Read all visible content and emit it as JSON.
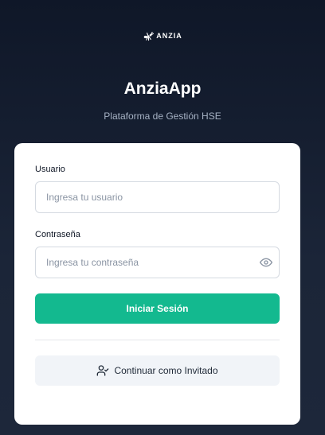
{
  "brand": {
    "logo_text": "ANZIA",
    "logo_icon": "ant-icon",
    "title": "AnziaApp",
    "subtitle": "Plataforma de Gestión HSE"
  },
  "login": {
    "username_label": "Usuario",
    "username_placeholder": "Ingresa tu usuario",
    "username_value": "",
    "password_label": "Contraseña",
    "password_placeholder": "Ingresa tu contraseña",
    "password_value": "",
    "password_toggle_icon": "eye-icon",
    "submit_label": "Iniciar Sesión",
    "guest_label": "Continuar como Invitado",
    "guest_icon": "user-check-icon"
  },
  "colors": {
    "background_top": "#0f1728",
    "background_bottom": "#1d273a",
    "primary": "#13b98f",
    "card": "#ffffff",
    "secondary_button": "#f1f4f8"
  }
}
